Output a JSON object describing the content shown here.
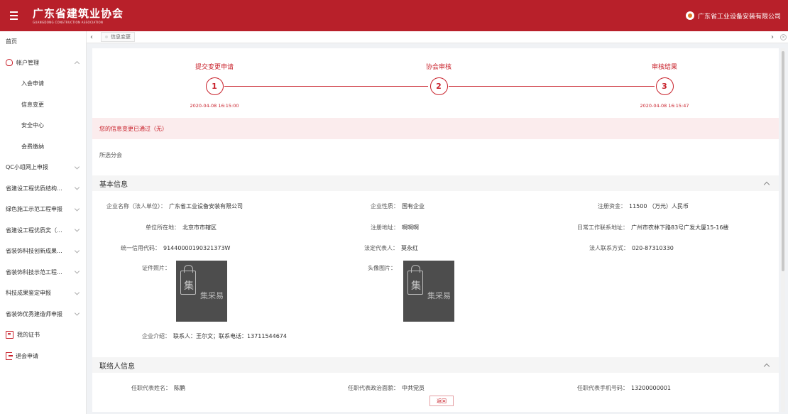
{
  "header": {
    "title": "广东省建筑业协会",
    "subtitle": "GUANGDONG CONSTRUCTION ASSOCIATION",
    "company": "广东省工业设备安装有限公司"
  },
  "sidebar": {
    "items": [
      {
        "label": "首页"
      },
      {
        "label": "帐户管理"
      },
      {
        "label": "入会申请"
      },
      {
        "label": "信息变更"
      },
      {
        "label": "安全中心"
      },
      {
        "label": "会费缴纳"
      },
      {
        "label": "QC小组网上申报"
      },
      {
        "label": "省建设工程优质结构..."
      },
      {
        "label": "绿色施工示范工程申报"
      },
      {
        "label": "省建设工程优质奖（..."
      },
      {
        "label": "省装饰科技创新成果..."
      },
      {
        "label": "省装饰科技示范工程..."
      },
      {
        "label": "科技成果鉴定申报"
      },
      {
        "label": "省装饰优秀建造师申报"
      },
      {
        "label": "我的证书"
      },
      {
        "label": "退会申请"
      }
    ]
  },
  "tabs": {
    "active": "信息变更"
  },
  "steps": [
    {
      "title": "提交变更申请",
      "number": "1",
      "time": "2020-04-08 16:15:00"
    },
    {
      "title": "协会审核",
      "number": "2",
      "time": ""
    },
    {
      "title": "审核结果",
      "number": "3",
      "time": "2020-04-08 16:15:47"
    }
  ],
  "notice": "您的信息变更已通过（无）",
  "branch_label": "所选分会",
  "basic": {
    "title": "基本信息",
    "company_name_label": "企业名称（法人单位）：",
    "company_name": "广东省工业设备安装有限公司",
    "nature_label": "企业性质：",
    "nature": "国有企业",
    "capital_label": "注册资金：",
    "capital": "11500 （万元）人民币",
    "location_label": "单位所在地：",
    "location": "北京市市辖区",
    "reg_address_label": "注册地址：",
    "reg_address": "啊啊啊",
    "office_address_label": "日常工作联系地址：",
    "office_address": "广州市农林下路83号广发大厦15-16楼",
    "credit_code_label": "统一信用代码：",
    "credit_code": "91440000190321373W",
    "legal_rep_label": "法定代表人：",
    "legal_rep": "莫永红",
    "legal_contact_label": "法人联系方式：",
    "legal_contact": "020-87310330",
    "cert_photo_label": "证件照片：",
    "head_photo_label": "头像图片：",
    "intro_label": "企业介绍：",
    "intro": "联系人：王尔文；联系电话：13711544674",
    "watermark_char": "集",
    "watermark_text": "集采易"
  },
  "contact": {
    "title": "联络人信息",
    "rep_name_label": "任职代表姓名：",
    "rep_name": "陈鹏",
    "rep_politics_label": "任职代表政治面貌：",
    "rep_politics": "中共党员",
    "rep_phone_label": "任职代表手机号码：",
    "rep_phone": "13200000001"
  },
  "buttons": {
    "return": "返回"
  },
  "colors": {
    "brand": "#b8202a",
    "accent": "#c8202a",
    "notice_bg": "#fbeced"
  }
}
